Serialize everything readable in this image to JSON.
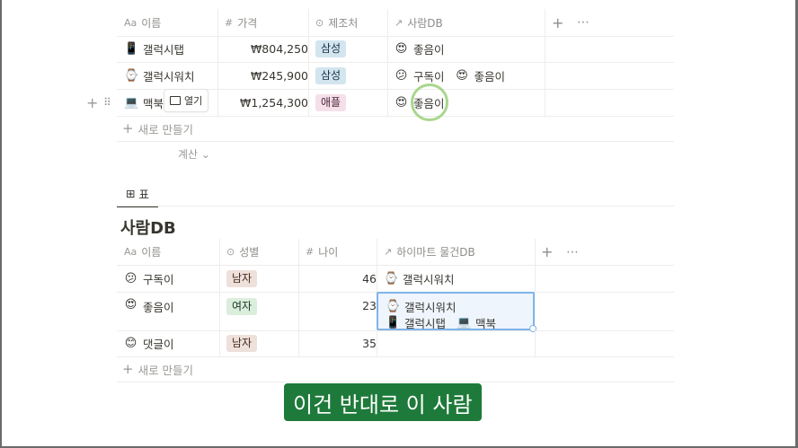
{
  "table1": {
    "headers": {
      "name": "이름",
      "price": "가격",
      "maker": "제조처",
      "relation": "사람DB"
    },
    "header_icons": {
      "name": "Aa",
      "price": "#",
      "maker": "⊙",
      "relation": "↗"
    },
    "add_column": "+",
    "more": "⋯",
    "rows": [
      {
        "icon": "📱",
        "name": "갤럭시탭",
        "price": "₩804,250",
        "maker": "삼성",
        "relations": [
          {
            "icon": "😍",
            "label": "좋음이"
          }
        ]
      },
      {
        "icon": "⌚",
        "name": "갤럭시워치",
        "price": "₩245,900",
        "maker": "삼성",
        "relations": [
          {
            "icon": "😕",
            "label": "구독이"
          },
          {
            "icon": "😍",
            "label": "좋음이"
          }
        ]
      },
      {
        "icon": "💻",
        "name": "맥북",
        "price": "₩1,254,300",
        "maker": "애플",
        "relations": [
          {
            "icon": "😍",
            "label": "좋음이"
          }
        ]
      }
    ],
    "open_label": "열기",
    "new_label": "새로 만들기",
    "calc_label": "계산 ⌄"
  },
  "view_tab": {
    "icon": "⊞",
    "label": "표"
  },
  "table2": {
    "title": "사람DB",
    "headers": {
      "name": "이름",
      "gender": "성별",
      "age": "나이",
      "relation": "하이마트 물건DB"
    },
    "header_icons": {
      "name": "Aa",
      "gender": "⊙",
      "age": "#",
      "relation": "↗"
    },
    "add_column": "+",
    "more": "⋯",
    "rows": [
      {
        "icon": "😕",
        "name": "구독이",
        "gender": "남자",
        "age": "46",
        "relations": [
          {
            "icon": "⌚",
            "label": "갤럭시워치"
          }
        ]
      },
      {
        "icon": "😍",
        "name": "좋음이",
        "gender": "여자",
        "age": "23",
        "relations": [
          {
            "icon": "⌚",
            "label": "갤럭시워치"
          },
          {
            "icon": "📱",
            "label": "갤럭시탭"
          },
          {
            "icon": "💻",
            "label": "맥북"
          }
        ]
      },
      {
        "icon": "😊",
        "name": "댓글이",
        "gender": "남자",
        "age": "35",
        "relations": []
      }
    ],
    "new_label": "새로 만들기"
  },
  "subtitle": "이건 반대로 이 사람",
  "row_handle": {
    "add": "+",
    "drag": "⠿"
  },
  "colors": {
    "tag_blue": "#d3e5ef",
    "tag_pink": "#f5e0e9",
    "tag_brown": "#eee0da",
    "tag_green": "#dbeddb",
    "subtitle_bg": "#1e7a3a",
    "selection": "#2383e2"
  }
}
